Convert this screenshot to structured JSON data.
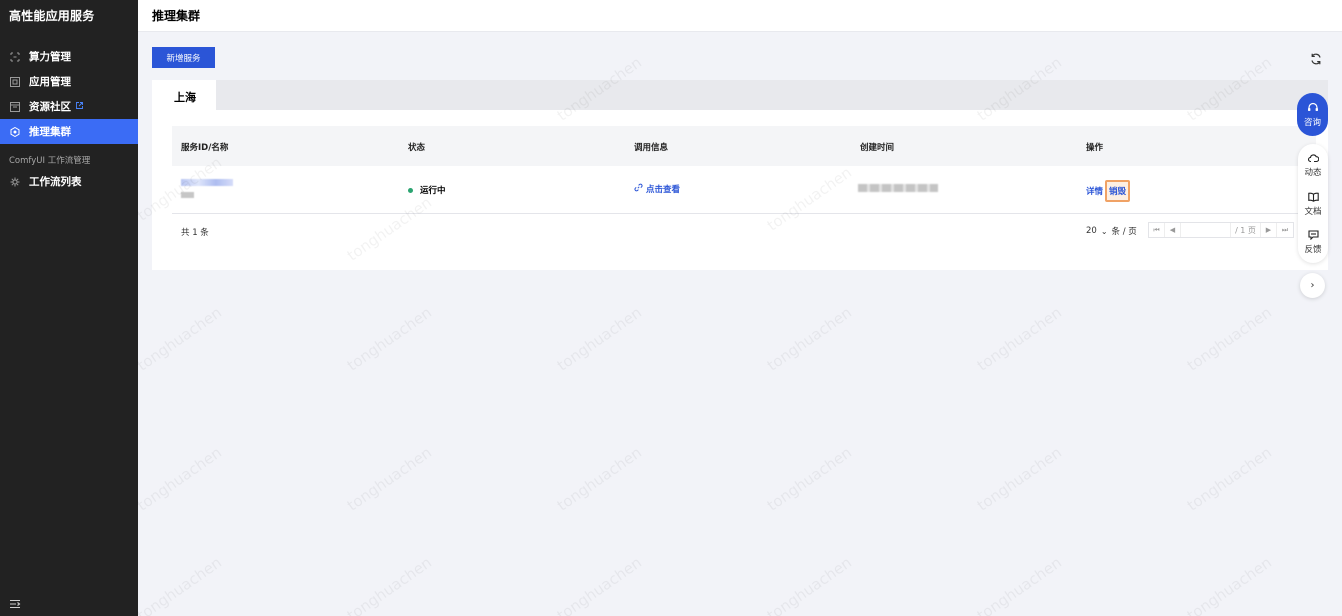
{
  "app": {
    "title": "高性能应用服务"
  },
  "sidebar": {
    "items": [
      {
        "label": "算力管理",
        "icon": "compute-icon"
      },
      {
        "label": "应用管理",
        "icon": "app-icon"
      },
      {
        "label": "资源社区",
        "icon": "community-icon",
        "external": true
      },
      {
        "label": "推理集群",
        "icon": "cluster-icon",
        "active": true
      }
    ],
    "section_label": "ComfyUI 工作流管理",
    "section_items": [
      {
        "label": "工作流列表",
        "icon": "workflow-icon"
      }
    ]
  },
  "header": {
    "title": "推理集群"
  },
  "toolbar": {
    "new_label": "新增服务"
  },
  "tabs": [
    {
      "label": "上海",
      "active": true
    }
  ],
  "table": {
    "columns": [
      "服务ID/名称",
      "状态",
      "调用信息",
      "创建时间",
      "操作"
    ],
    "rows": [
      {
        "status": "运行中",
        "call_info": "点击查看",
        "actions": [
          "详情",
          "销毁"
        ]
      }
    ]
  },
  "pagination": {
    "total_label": "共 1 条",
    "page_size": "20",
    "page_size_unit": "条 / 页",
    "total_pages": "/ 1 页"
  },
  "float": {
    "consult": "咨询",
    "items": [
      "动态",
      "文档",
      "反馈"
    ]
  },
  "colors": {
    "accent": "#2b55d7",
    "sidebar_bg": "#222222",
    "active_nav": "#3b6cf5",
    "status_running": "#2ba471",
    "highlight": "#f0a265"
  }
}
